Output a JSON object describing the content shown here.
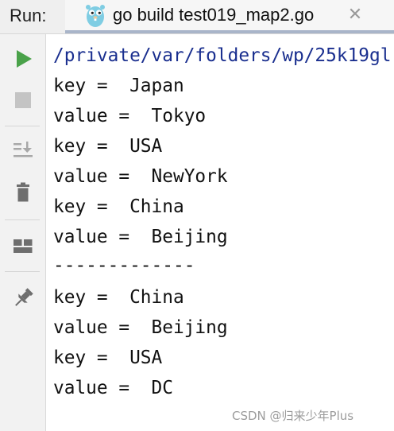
{
  "header": {
    "run_label": "Run:",
    "tab": {
      "title": "go build test019_map2.go",
      "icon": "gopher-icon",
      "close_glyph": "✕"
    }
  },
  "toolbar": {
    "buttons": [
      {
        "name": "run-button",
        "icon": "play-icon",
        "color": "#4aa24a"
      },
      {
        "name": "stop-button",
        "icon": "stop-icon",
        "color": "#c4c4c4"
      },
      {
        "name": "scroll-to-end-button",
        "icon": "scroll-down-icon",
        "color": "#a8a8a8"
      },
      {
        "name": "clear-button",
        "icon": "trash-icon",
        "color": "#6e6e6e"
      },
      {
        "name": "layout-button",
        "icon": "layout-icon",
        "color": "#6e6e6e"
      },
      {
        "name": "pin-button",
        "icon": "pin-icon",
        "color": "#6e6e6e"
      }
    ]
  },
  "console": {
    "lines": [
      "/private/var/folders/wp/25k19gl",
      "key =  Japan",
      "value =  Tokyo",
      "key =  USA",
      "value =  NewYork",
      "key =  China",
      "value =  Beijing",
      "-------------",
      "key =  China",
      "value =  Beijing",
      "key =  USA",
      "value =  DC"
    ]
  },
  "watermark": "CSDN @归来少年Plus"
}
